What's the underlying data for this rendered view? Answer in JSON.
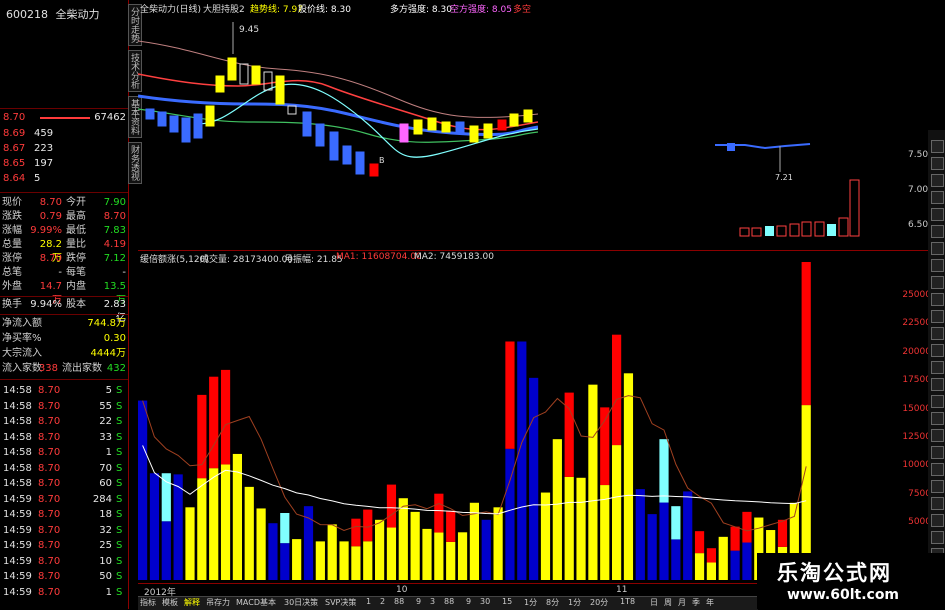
{
  "stock": {
    "code": "600218",
    "name": "全柴动力"
  },
  "left_top": {
    "price1": "8.70",
    "vol1": "67462"
  },
  "book": [
    {
      "price": "8.69",
      "vol": "459"
    },
    {
      "price": "8.67",
      "vol": "223"
    },
    {
      "price": "8.65",
      "vol": "197"
    },
    {
      "price": "8.64",
      "vol": "5"
    }
  ],
  "quote": {
    "r1": {
      "l1": "现价",
      "v1": "8.70",
      "l2": "今开",
      "v2": "7.90"
    },
    "r2": {
      "l1": "涨跌",
      "v1": "0.79",
      "l2": "最高",
      "v2": "8.70"
    },
    "r3": {
      "l1": "涨幅",
      "v1": "9.99%",
      "l2": "最低",
      "v2": "7.83"
    },
    "r4": {
      "l1": "总量",
      "v1": "28.2万",
      "l2": "量比",
      "v2": "4.19"
    },
    "r5": {
      "l1": "涨停",
      "v1": "8.70",
      "l2": "跌停",
      "v2": "7.12"
    },
    "r6": {
      "l1": "总笔",
      "v1": "-",
      "l2": "每笔",
      "v2": "-"
    },
    "r7": {
      "l1": "外盘",
      "v1": "14.7万",
      "l2": "内盘",
      "v2": "13.5万"
    },
    "r8": {
      "l1": "换手",
      "v1": "9.94%",
      "l2": "股本",
      "v2": "2.83亿"
    },
    "r9": {
      "l1": "净流入额",
      "v1": "744.8万"
    },
    "r10": {
      "l1": "净买率%",
      "v1": "0.30"
    },
    "r11": {
      "l1": "大宗流入",
      "v1": "4444万"
    },
    "r12": {
      "l1": "流入家数",
      "v1": "338",
      "l2": "流出家数",
      "v2": "432"
    }
  },
  "ticks": [
    {
      "time": "14:58",
      "price": "8.70",
      "vol": "5",
      "bs": "S"
    },
    {
      "time": "14:58",
      "price": "8.70",
      "vol": "55",
      "bs": "S"
    },
    {
      "time": "14:58",
      "price": "8.70",
      "vol": "22",
      "bs": "S"
    },
    {
      "time": "14:58",
      "price": "8.70",
      "vol": "33",
      "bs": "S"
    },
    {
      "time": "14:58",
      "price": "8.70",
      "vol": "1",
      "bs": "S"
    },
    {
      "time": "14:58",
      "price": "8.70",
      "vol": "70",
      "bs": "S"
    },
    {
      "time": "14:58",
      "price": "8.70",
      "vol": "60",
      "bs": "S"
    },
    {
      "time": "14:59",
      "price": "8.70",
      "vol": "284",
      "bs": "S"
    },
    {
      "time": "14:59",
      "price": "8.70",
      "vol": "18",
      "bs": "S"
    },
    {
      "time": "14:59",
      "price": "8.70",
      "vol": "32",
      "bs": "S"
    },
    {
      "time": "14:59",
      "price": "8.70",
      "vol": "25",
      "bs": "S"
    },
    {
      "time": "14:59",
      "price": "8.70",
      "vol": "10",
      "bs": "S"
    },
    {
      "time": "14:59",
      "price": "8.70",
      "vol": "50",
      "bs": "S"
    },
    {
      "time": "14:59",
      "price": "8.70",
      "vol": "1",
      "bs": "S"
    }
  ],
  "vtabs": [
    "分时走势",
    "技术分析",
    "基本资料",
    "财务透视"
  ],
  "kline_header": {
    "title": "全柴动力(日线)",
    "ind1": "大胆持股2",
    "ind2": "趋势线: 7.97",
    "ind3": "股价线: 8.30",
    "ind4": "多方强度: 8.30",
    "ind5": "空方强度: 8.05",
    "ind6": "多空"
  },
  "kline_labels": {
    "high": "9.45",
    "low": "7.21"
  },
  "price_axis": [
    "7.50",
    "7.00",
    "6.50"
  ],
  "volume_header": {
    "title": "缓倍额涨(5,120)",
    "vol": "成交量: 28173400.00",
    "amp": "月振幅: 21.85",
    "ma1": "MA1: 11608704.00",
    "ma2": "MA2: 7459183.00"
  },
  "volume_axis": [
    "25000",
    "22500",
    "20000",
    "17500",
    "15000",
    "12500",
    "10000",
    "7500",
    "5000"
  ],
  "x_labels": {
    "year": "2012年",
    "m10": "10",
    "m11": "11"
  },
  "bottom_tabs": [
    "指标",
    "模板",
    "解释",
    "吊存力",
    "MACD基本",
    "30日决策",
    "SVP决策",
    "1",
    "2",
    "88",
    "9",
    "3",
    "88",
    "9",
    "30",
    "15",
    "1分",
    "8分",
    "1分",
    "20分",
    "1T8",
    "日",
    "周",
    "月",
    "季",
    "年"
  ],
  "watermark": {
    "line1": "乐淘公式网",
    "line2": "www.60lt.com"
  },
  "colors": {
    "up": "#ff0000",
    "down": "#0000cc",
    "yellow": "#ffff00",
    "cyan": "#80ffff",
    "bg": "#000000"
  },
  "chart_data": {
    "type": "bar",
    "title": "缓倍额涨(5,120)",
    "series": [
      {
        "name": "成交量",
        "values": [
          15800,
          9400,
          9400,
          9300,
          6400,
          16300,
          17900,
          18500,
          11100,
          8200,
          6300,
          5000,
          5900,
          3600,
          6500,
          3400,
          4900,
          3400,
          5400,
          6200,
          5300,
          8400,
          7200,
          6000,
          4500,
          7600,
          6100,
          4200,
          6800,
          5300,
          6400,
          21000,
          21000,
          17800,
          7700,
          12400,
          16500,
          9000,
          17200,
          15200,
          21600,
          18200,
          8000,
          5800,
          12400,
          6500,
          7800,
          4300,
          2800,
          3800,
          4700,
          6000,
          5500,
          4400,
          5300,
          6800,
          28000
        ]
      }
    ],
    "ylim": [
      0,
      28000
    ],
    "yticks": [
      5000,
      7500,
      10000,
      12500,
      15000,
      17500,
      20000,
      22500,
      25000
    ]
  }
}
